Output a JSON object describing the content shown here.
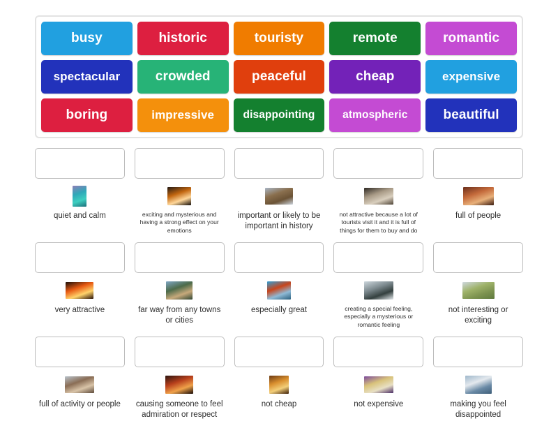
{
  "activity": {
    "type": "match-up-drag-and-drop",
    "colors": {
      "tile_busy": "#21a0e0",
      "tile_historic": "#dd1f40",
      "tile_touristy": "#f07c00",
      "tile_remote": "#14802f",
      "tile_romantic": "#c council"
    }
  },
  "tile_bank": {
    "rows": [
      [
        {
          "label": "busy",
          "color": "#21a0e0",
          "size": "normal"
        },
        {
          "label": "historic",
          "color": "#dd1f40",
          "size": "normal"
        },
        {
          "label": "touristy",
          "color": "#f07c00",
          "size": "normal"
        },
        {
          "label": "remote",
          "color": "#14802f",
          "size": "normal"
        },
        {
          "label": "romantic",
          "color": "#c councilTBD",
          "size": "normal"
        }
      ]
    ]
  },
  "tiles": [
    {
      "label": "busy",
      "color": "#21a0e0",
      "size": "normal"
    },
    {
      "label": "historic",
      "color": "#dd1f40",
      "size": "normal"
    },
    {
      "label": "touristy",
      "color": "#f07c00",
      "size": "normal"
    },
    {
      "label": "remote",
      "color": "#14802f",
      "size": "normal"
    },
    {
      "label": "romantic",
      "color": "#c champ",
      "size": "normal"
    },
    {
      "label": "spectacular",
      "color": "#2232bb",
      "size": "small"
    },
    {
      "label": "crowded",
      "color": "#27b377",
      "size": "normal"
    },
    {
      "label": "peaceful",
      "color": "#e03f0d",
      "size": "normal"
    },
    {
      "label": "cheap",
      "color": "#7322b8",
      "size": "normal"
    },
    {
      "label": "expensive",
      "color": "#21a0e0",
      "size": "small"
    },
    {
      "label": "boring",
      "color": "#dd1f40",
      "size": "normal"
    },
    {
      "label": "impressive",
      "color": "#f4900c",
      "size": "small"
    },
    {
      "label": "disappointing",
      "color": "#14802f",
      "size": "xsmall"
    },
    {
      "label": "atmospheric",
      "color": "#c champ2",
      "size": "xsmall"
    },
    {
      "label": "beautiful",
      "color": "#2232bb",
      "size": "normal"
    }
  ],
  "answers": [
    {
      "definition": "quiet and calm",
      "definition_size": "normal",
      "thumb": {
        "name": "lagoon-photo",
        "width": 20,
        "height": 30,
        "colors": [
          "#8d7fb8",
          "#2fa8b8",
          "#3ecfc0",
          "#1c6f7a"
        ]
      }
    },
    {
      "definition": "exciting and mysterious and having a strong effect on your emotions",
      "definition_size": "tiny",
      "thumb": {
        "name": "night-city-photo",
        "width": 34,
        "height": 26,
        "colors": [
          "#241a14",
          "#c2660f",
          "#ffd79a",
          "#120c08"
        ]
      }
    },
    {
      "definition": "important or likely to be important in history",
      "definition_size": "normal",
      "thumb": {
        "name": "great-wall-photo",
        "width": 40,
        "height": 24,
        "colors": [
          "#a9b6c6",
          "#8a6f4e",
          "#6b5336",
          "#cbd4de"
        ]
      }
    },
    {
      "definition": "not attractive  because a lot of tourists visit it and it is full of things for them to buy and do",
      "definition_size": "tiny",
      "thumb": {
        "name": "tourist-crowd-photo",
        "width": 42,
        "height": 24,
        "colors": [
          "#2c2722",
          "#a89a86",
          "#d9cfbe",
          "#504538"
        ]
      }
    },
    {
      "definition": "full of people",
      "definition_size": "normal",
      "thumb": {
        "name": "crowd-photo",
        "width": 44,
        "height": 26,
        "colors": [
          "#6b2f1c",
          "#c46a3b",
          "#e8b07a",
          "#3a1b10"
        ]
      }
    },
    {
      "definition": "very attractive",
      "definition_size": "normal",
      "thumb": {
        "name": "sunset-photo",
        "width": 40,
        "height": 24,
        "colors": [
          "#1a0d08",
          "#e85a12",
          "#ffd36b",
          "#2b1509"
        ]
      }
    },
    {
      "definition": "far way from any towns or cities",
      "definition_size": "normal",
      "thumb": {
        "name": "hiker-cliff-photo",
        "width": 38,
        "height": 26,
        "colors": [
          "#7fa6c4",
          "#4d6b4a",
          "#c7a97b",
          "#2f4633"
        ]
      }
    },
    {
      "definition": "especially great",
      "definition_size": "normal",
      "thumb": {
        "name": "golden-gate-bridge-photo",
        "width": 34,
        "height": 26,
        "colors": [
          "#2f9fd6",
          "#c8451c",
          "#8fbad6",
          "#2a5f7d"
        ]
      }
    },
    {
      "definition": "creating a special feeling, especially a mysterious or romantic feeling",
      "definition_size": "tiny",
      "thumb": {
        "name": "misty-mountain-photo",
        "width": 42,
        "height": 26,
        "colors": [
          "#cdd7dd",
          "#7d8a8f",
          "#34403f",
          "#e3e9ec"
        ]
      }
    },
    {
      "definition": "not interesting or exciting",
      "definition_size": "normal",
      "thumb": {
        "name": "empty-field-photo",
        "width": 46,
        "height": 24,
        "colors": [
          "#cfd8de",
          "#9fb36a",
          "#7d9350",
          "#5f7a3e"
        ]
      }
    },
    {
      "definition": "full of activity or people",
      "definition_size": "normal",
      "thumb": {
        "name": "market-street-photo",
        "width": 42,
        "height": 24,
        "colors": [
          "#b9c3cc",
          "#8a6d55",
          "#d9c4a8",
          "#5d4a3a"
        ]
      }
    },
    {
      "definition": "causing someone to feel admiration or respect",
      "definition_size": "normal",
      "thumb": {
        "name": "temple-sunset-photo",
        "width": 40,
        "height": 26,
        "colors": [
          "#2a1410",
          "#b8401c",
          "#f0a24a",
          "#160a06"
        ]
      }
    },
    {
      "definition": "not cheap",
      "definition_size": "normal",
      "thumb": {
        "name": "golden-temple-photo",
        "width": 28,
        "height": 26,
        "colors": [
          "#6b3a14",
          "#d98f2e",
          "#f3cf7a",
          "#3d1f08"
        ]
      }
    },
    {
      "definition": "not expensive",
      "definition_size": "normal",
      "thumb": {
        "name": "flower-market-photo",
        "width": 42,
        "height": 24,
        "colors": [
          "#7b4a9e",
          "#d8c27a",
          "#e8e0c4",
          "#4a2c66"
        ]
      }
    },
    {
      "definition": "making you feel disappointed",
      "definition_size": "normal",
      "thumb": {
        "name": "cloudy-coast-photo",
        "width": 38,
        "height": 26,
        "colors": [
          "#9fb8cc",
          "#e4e9ee",
          "#6a8aa6",
          "#3f5f7a"
        ]
      }
    }
  ]
}
